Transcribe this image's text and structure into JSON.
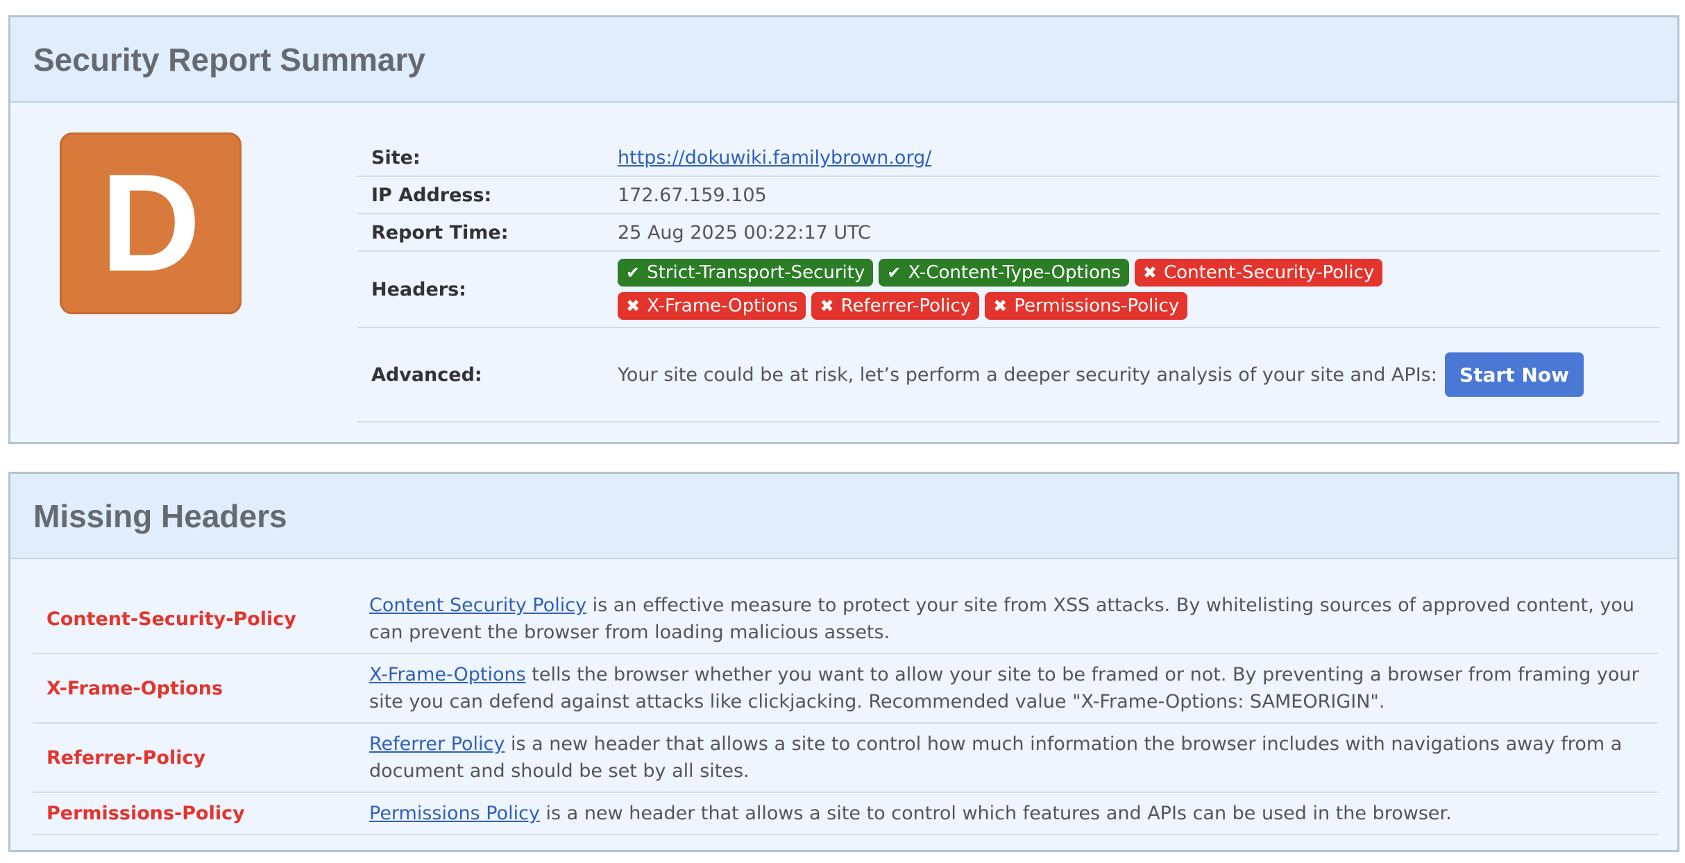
{
  "summary": {
    "title": "Security Report Summary",
    "grade": "D",
    "grade_color": "#d77a3c",
    "labels": {
      "site": "Site:",
      "ip": "IP Address:",
      "time": "Report Time:",
      "headers": "Headers:",
      "advanced": "Advanced:"
    },
    "site_url": "https://dokuwiki.familybrown.org/",
    "ip": "172.67.159.105",
    "report_time": "25 Aug 2025 00:22:17 UTC",
    "headers": [
      {
        "name": "Strict-Transport-Security",
        "present": true,
        "icon": "check-icon"
      },
      {
        "name": "X-Content-Type-Options",
        "present": true,
        "icon": "check-icon"
      },
      {
        "name": "Content-Security-Policy",
        "present": false,
        "icon": "cross-icon"
      },
      {
        "name": "X-Frame-Options",
        "present": false,
        "icon": "cross-icon"
      },
      {
        "name": "Referrer-Policy",
        "present": false,
        "icon": "cross-icon"
      },
      {
        "name": "Permissions-Policy",
        "present": false,
        "icon": "cross-icon"
      }
    ],
    "advanced_text": "Your site could be at risk, let’s perform a deeper security analysis of your site and APIs:",
    "start_button": "Start Now"
  },
  "missing": {
    "title": "Missing Headers",
    "rows": [
      {
        "name": "Content-Security-Policy",
        "link": "Content Security Policy",
        "desc": " is an effective measure to protect your site from XSS attacks. By whitelisting sources of approved content, you can prevent the browser from loading malicious assets."
      },
      {
        "name": "X-Frame-Options",
        "link": "X-Frame-Options",
        "desc": " tells the browser whether you want to allow your site to be framed or not. By preventing a browser from framing your site you can defend against attacks like clickjacking. Recommended value \"X-Frame-Options: SAMEORIGIN\"."
      },
      {
        "name": "Referrer-Policy",
        "link": "Referrer Policy",
        "desc": " is a new header that allows a site to control how much information the browser includes with navigations away from a document and should be set by all sites."
      },
      {
        "name": "Permissions-Policy",
        "link": "Permissions Policy",
        "desc": " is a new header that allows a site to control which features and APIs can be used in the browser."
      }
    ]
  },
  "colors": {
    "ok": "#2b7d26",
    "bad": "#e3352d",
    "link": "#2f5fbf",
    "button": "#4a78d4"
  }
}
